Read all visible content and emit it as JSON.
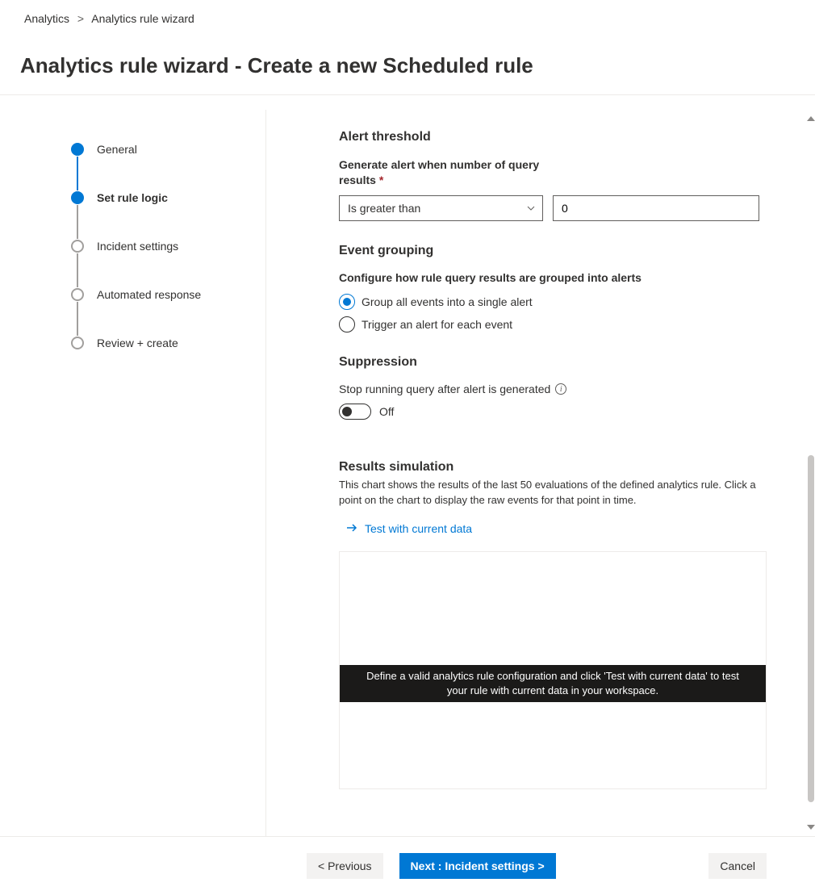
{
  "breadcrumb": {
    "root": "Analytics",
    "current": "Analytics rule wizard"
  },
  "page_title": "Analytics rule wizard - Create a new Scheduled rule",
  "steps": [
    {
      "label": "General"
    },
    {
      "label": "Set rule logic"
    },
    {
      "label": "Incident settings"
    },
    {
      "label": "Automated response"
    },
    {
      "label": "Review + create"
    }
  ],
  "alert_threshold": {
    "heading": "Alert threshold",
    "field_label": "Generate alert when number of query results",
    "operator": "Is greater than",
    "value": "0"
  },
  "event_grouping": {
    "heading": "Event grouping",
    "subtext": "Configure how rule query results are grouped into alerts",
    "opt1": "Group all events into a single alert",
    "opt2": "Trigger an alert for each event"
  },
  "suppression": {
    "heading": "Suppression",
    "label": "Stop running query after alert is generated",
    "state": "Off"
  },
  "results": {
    "heading": "Results simulation",
    "desc": "This chart shows the results of the last 50 evaluations of the defined analytics rule. Click a point on the chart to display the raw events for that point in time.",
    "test_link": "Test with current data",
    "placeholder": "Define a valid analytics rule configuration and click 'Test with current data' to test your rule with current data in your workspace."
  },
  "footer": {
    "prev": "< Previous",
    "next": "Next : Incident settings >",
    "cancel": "Cancel"
  }
}
